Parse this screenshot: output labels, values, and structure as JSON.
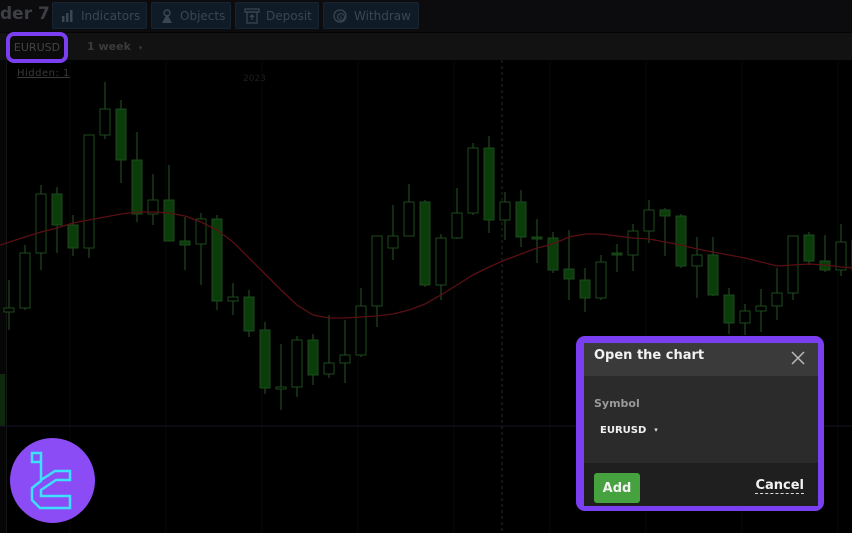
{
  "app": {
    "title_fragment": "der 7"
  },
  "toolbar": {
    "buttons": [
      {
        "label": "Indicators",
        "icon": "bar-chart-icon"
      },
      {
        "label": "Objects",
        "icon": "objects-icon"
      },
      {
        "label": "Deposit",
        "icon": "deposit-icon"
      },
      {
        "label": "Withdraw",
        "icon": "withdraw-icon"
      }
    ]
  },
  "chart_tab": {
    "symbol": "EURUSD",
    "period": "1 week",
    "period_caret": "▾"
  },
  "chart_overlay": {
    "hidden_link": "Hidden: 1",
    "year_label": "2023"
  },
  "highlight_color": "#7b3ff2",
  "dialog": {
    "title": "Open the chart",
    "symbol_label": "Symbol",
    "symbol_value": "EURUSD",
    "symbol_caret": "▾",
    "add_label": "Add",
    "cancel_label": "Cancel",
    "add_color": "#46a23e"
  },
  "chart_data": {
    "type": "candlestick",
    "title": "",
    "symbol": "EURUSD",
    "timeframe": "1 week",
    "bull_style": "hollow",
    "bear_style": "filled",
    "colors": {
      "candle": "#0b3d0b",
      "candle_outline": "#1d4a1d",
      "moving_average": "#5a0f14",
      "crosshair": "#2a2a2a"
    },
    "y_scale_units": "relative price",
    "ylim": [
      0.95,
      1.37
    ],
    "candles": [
      {
        "o": 1.118,
        "h": 1.15,
        "l": 1.1,
        "c": 1.122
      },
      {
        "o": 1.122,
        "h": 1.185,
        "l": 1.12,
        "c": 1.177
      },
      {
        "o": 1.177,
        "h": 1.245,
        "l": 1.16,
        "c": 1.236
      },
      {
        "o": 1.236,
        "h": 1.243,
        "l": 1.177,
        "c": 1.205
      },
      {
        "o": 1.205,
        "h": 1.215,
        "l": 1.174,
        "c": 1.182
      },
      {
        "o": 1.182,
        "h": 1.295,
        "l": 1.172,
        "c": 1.295
      },
      {
        "o": 1.295,
        "h": 1.348,
        "l": 1.291,
        "c": 1.321
      },
      {
        "o": 1.321,
        "h": 1.33,
        "l": 1.247,
        "c": 1.27
      },
      {
        "o": 1.27,
        "h": 1.298,
        "l": 1.208,
        "c": 1.216
      },
      {
        "o": 1.216,
        "h": 1.256,
        "l": 1.205,
        "c": 1.23
      },
      {
        "o": 1.23,
        "h": 1.265,
        "l": 1.189,
        "c": 1.189
      },
      {
        "o": 1.189,
        "h": 1.213,
        "l": 1.16,
        "c": 1.185
      },
      {
        "o": 1.186,
        "h": 1.217,
        "l": 1.145,
        "c": 1.211
      },
      {
        "o": 1.211,
        "h": 1.215,
        "l": 1.12,
        "c": 1.129
      },
      {
        "o": 1.129,
        "h": 1.147,
        "l": 1.115,
        "c": 1.133
      },
      {
        "o": 1.133,
        "h": 1.14,
        "l": 1.093,
        "c": 1.099
      },
      {
        "o": 1.1,
        "h": 1.108,
        "l": 1.036,
        "c": 1.042
      },
      {
        "o": 1.042,
        "h": 1.086,
        "l": 1.02,
        "c": 1.043
      },
      {
        "o": 1.043,
        "h": 1.094,
        "l": 1.033,
        "c": 1.09
      },
      {
        "o": 1.09,
        "h": 1.096,
        "l": 1.045,
        "c": 1.055
      },
      {
        "o": 1.056,
        "h": 1.115,
        "l": 1.052,
        "c": 1.067
      },
      {
        "o": 1.067,
        "h": 1.11,
        "l": 1.047,
        "c": 1.075
      },
      {
        "o": 1.075,
        "h": 1.142,
        "l": 1.073,
        "c": 1.124
      },
      {
        "o": 1.124,
        "h": 1.193,
        "l": 1.103,
        "c": 1.194
      },
      {
        "o": 1.182,
        "h": 1.225,
        "l": 1.17,
        "c": 1.194
      },
      {
        "o": 1.194,
        "h": 1.246,
        "l": 1.194,
        "c": 1.228
      },
      {
        "o": 1.228,
        "h": 1.23,
        "l": 1.143,
        "c": 1.145
      },
      {
        "o": 1.145,
        "h": 1.196,
        "l": 1.13,
        "c": 1.192
      },
      {
        "o": 1.192,
        "h": 1.242,
        "l": 1.191,
        "c": 1.217
      },
      {
        "o": 1.217,
        "h": 1.287,
        "l": 1.215,
        "c": 1.282
      },
      {
        "o": 1.282,
        "h": 1.294,
        "l": 1.197,
        "c": 1.21
      },
      {
        "o": 1.21,
        "h": 1.238,
        "l": 1.19,
        "c": 1.228
      },
      {
        "o": 1.228,
        "h": 1.24,
        "l": 1.183,
        "c": 1.193
      },
      {
        "o": 1.193,
        "h": 1.211,
        "l": 1.167,
        "c": 1.191
      },
      {
        "o": 1.192,
        "h": 1.198,
        "l": 1.157,
        "c": 1.16
      },
      {
        "o": 1.161,
        "h": 1.2,
        "l": 1.13,
        "c": 1.151
      },
      {
        "o": 1.15,
        "h": 1.162,
        "l": 1.118,
        "c": 1.132
      },
      {
        "o": 1.132,
        "h": 1.175,
        "l": 1.13,
        "c": 1.168
      },
      {
        "o": 1.177,
        "h": 1.186,
        "l": 1.158,
        "c": 1.175
      },
      {
        "o": 1.175,
        "h": 1.206,
        "l": 1.159,
        "c": 1.199
      },
      {
        "o": 1.199,
        "h": 1.23,
        "l": 1.187,
        "c": 1.22
      },
      {
        "o": 1.22,
        "h": 1.222,
        "l": 1.174,
        "c": 1.214
      },
      {
        "o": 1.214,
        "h": 1.216,
        "l": 1.162,
        "c": 1.164
      },
      {
        "o": 1.164,
        "h": 1.193,
        "l": 1.132,
        "c": 1.175
      },
      {
        "o": 1.175,
        "h": 1.193,
        "l": 1.134,
        "c": 1.135
      },
      {
        "o": 1.135,
        "h": 1.142,
        "l": 1.096,
        "c": 1.107
      },
      {
        "o": 1.107,
        "h": 1.126,
        "l": 1.095,
        "c": 1.119
      },
      {
        "o": 1.119,
        "h": 1.141,
        "l": 1.098,
        "c": 1.124
      },
      {
        "o": 1.124,
        "h": 1.162,
        "l": 1.11,
        "c": 1.137
      },
      {
        "o": 1.137,
        "h": 1.194,
        "l": 1.13,
        "c": 1.194
      },
      {
        "o": 1.195,
        "h": 1.198,
        "l": 1.165,
        "c": 1.169
      },
      {
        "o": 1.169,
        "h": 1.195,
        "l": 1.158,
        "c": 1.16
      },
      {
        "o": 1.16,
        "h": 1.206,
        "l": 1.154,
        "c": 1.188
      },
      {
        "o": 1.19,
        "h": 1.2,
        "l": 1.15,
        "c": 1.16
      }
    ],
    "moving_average": [
      1.185,
      1.193,
      1.198,
      1.202,
      1.207,
      1.21,
      1.213,
      1.216,
      1.218,
      1.218,
      1.217,
      1.214,
      1.208,
      1.2,
      1.188,
      1.172,
      1.156,
      1.14,
      1.125,
      1.115,
      1.112,
      1.112,
      1.113,
      1.114,
      1.116,
      1.12,
      1.126,
      1.135,
      1.145,
      1.155,
      1.163,
      1.17,
      1.176,
      1.182,
      1.186,
      1.193,
      1.196,
      1.196,
      1.194,
      1.192,
      1.191,
      1.188,
      1.185,
      1.181,
      1.178,
      1.175,
      1.172,
      1.168,
      1.164,
      1.165,
      1.166,
      1.165,
      1.163,
      1.162
    ]
  }
}
